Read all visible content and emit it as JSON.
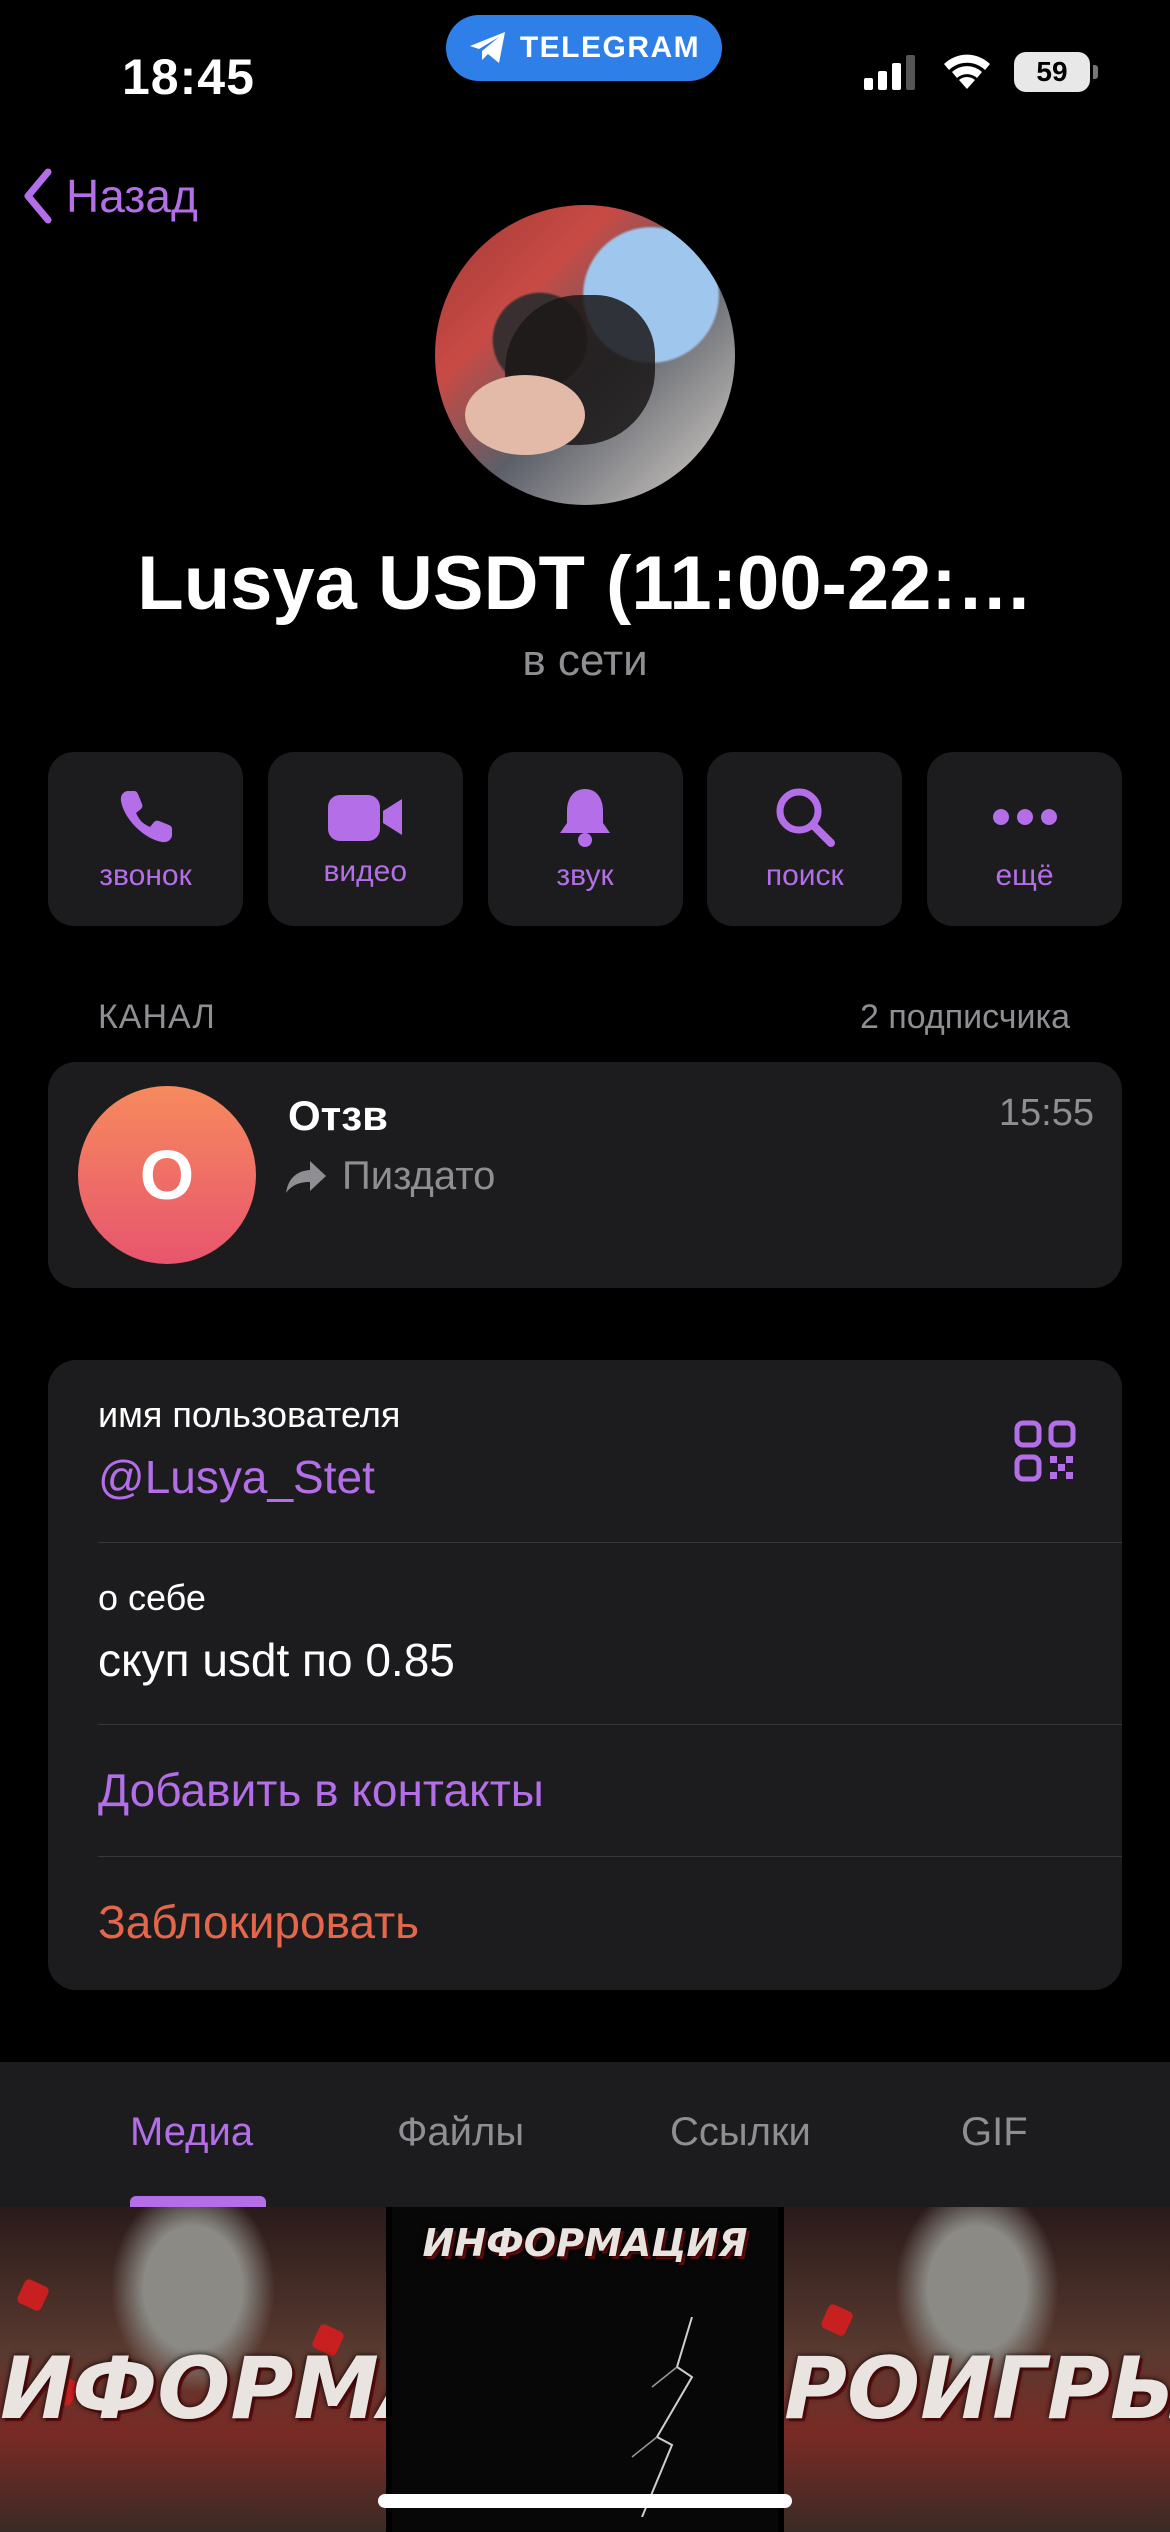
{
  "status_bar": {
    "time": "18:45",
    "app_pill": "TELEGRAM",
    "battery": "59"
  },
  "nav": {
    "back_label": "Назад"
  },
  "profile": {
    "name": "Lusya USDT (11:00-22:…",
    "status": "в сети"
  },
  "actions": [
    {
      "label": "звонок",
      "icon": "phone-icon"
    },
    {
      "label": "видео",
      "icon": "video-icon"
    },
    {
      "label": "звук",
      "icon": "bell-icon"
    },
    {
      "label": "поиск",
      "icon": "search-icon"
    },
    {
      "label": "ещё",
      "icon": "more-icon"
    }
  ],
  "channel": {
    "section_label": "КАНАЛ",
    "subscribers": "2 подписчика",
    "avatar_letter": "О",
    "title": "Отзв",
    "time": "15:55",
    "last_message": "Пиздато"
  },
  "info": {
    "username_label": "имя пользователя",
    "username": "@Lusya_Stet",
    "bio_label": "о себе",
    "bio": "скуп usdt по 0.85",
    "add_contact": "Добавить в контакты",
    "block": "Заблокировать"
  },
  "tabs": [
    {
      "label": "Медиа",
      "active": true
    },
    {
      "label": "Файлы",
      "active": false
    },
    {
      "label": "Ссылки",
      "active": false
    },
    {
      "label": "GIF",
      "active": false
    }
  ],
  "media": [
    {
      "caption": "ИФОРМАЦИ"
    },
    {
      "caption": "ИНФОРМАЦИЯ"
    },
    {
      "caption": "РОИГРЫШ"
    }
  ],
  "colors": {
    "accent": "#b36ee8",
    "danger": "#e4674c",
    "card": "#1c1c1e",
    "pill": "#2f7fe8"
  }
}
